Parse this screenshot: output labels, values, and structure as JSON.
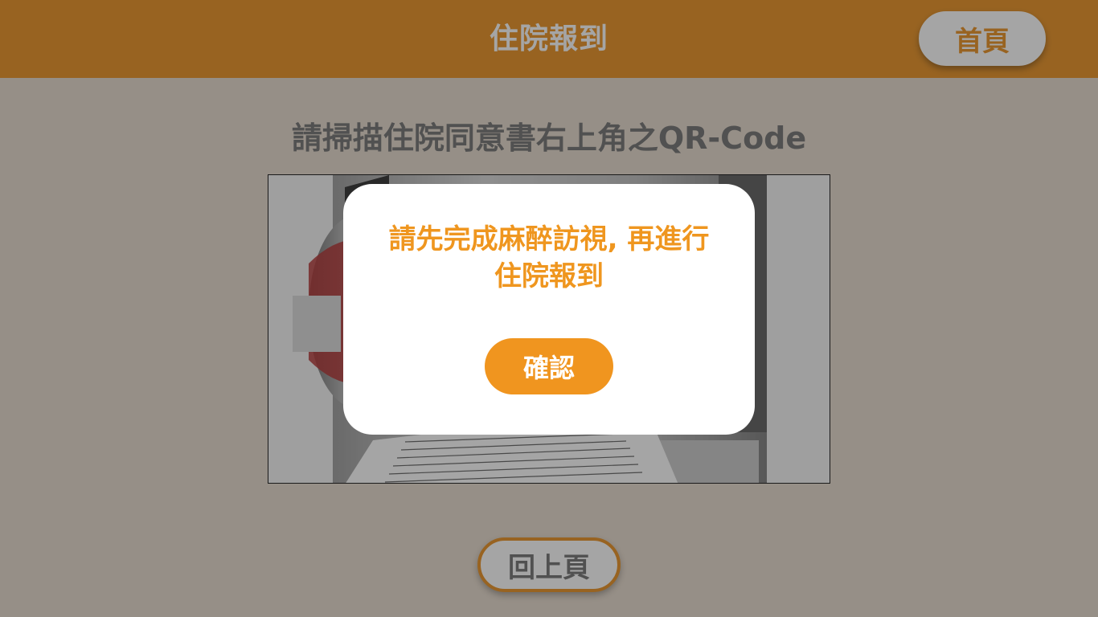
{
  "header": {
    "title": "住院報到",
    "home_label": "首頁"
  },
  "instruction": "請掃描住院同意書右上角之QR-Code",
  "camera": {
    "icon": "printer-with-document-illustration"
  },
  "footer": {
    "back_label": "回上頁"
  },
  "dialog": {
    "message_line1": "請先完成麻醉訪視, 再進行",
    "message_line2": "住院報到",
    "confirm_label": "確認"
  },
  "colors": {
    "brand_orange": "#e88e1d",
    "dialog_text": "#ef961f",
    "button_orange": "#f0951f",
    "overlay": "rgba(40,40,40,0.42)"
  }
}
